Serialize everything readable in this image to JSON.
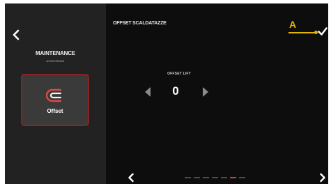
{
  "colors": {
    "screen_bg": "#0d0d0d",
    "sidebar_bg": "#222222",
    "tile_bg": "#3a3a3a",
    "tile_border": "#8a2424",
    "accent_red": "#d93a2a",
    "annotation": "#e3b505"
  },
  "sidebar": {
    "back_icon": "chevron-left-icon",
    "title": "MAINTENANCE",
    "subtitle": "ASSISTENZA",
    "tile": {
      "icon": "offset-icon",
      "label": "Offset"
    }
  },
  "main": {
    "title": "OFFSET SCALDATAZZE",
    "annotation_marker": "A",
    "confirm_icon": "checkmark-icon",
    "offset": {
      "label": "OFFSET LIFT",
      "value": "0",
      "decrement_icon": "triangle-left-icon",
      "increment_icon": "triangle-right-icon"
    }
  },
  "pager": {
    "prev_icon": "chevron-left-icon",
    "next_icon": "chevron-right-icon",
    "page_count": 7,
    "active_page": 6
  }
}
